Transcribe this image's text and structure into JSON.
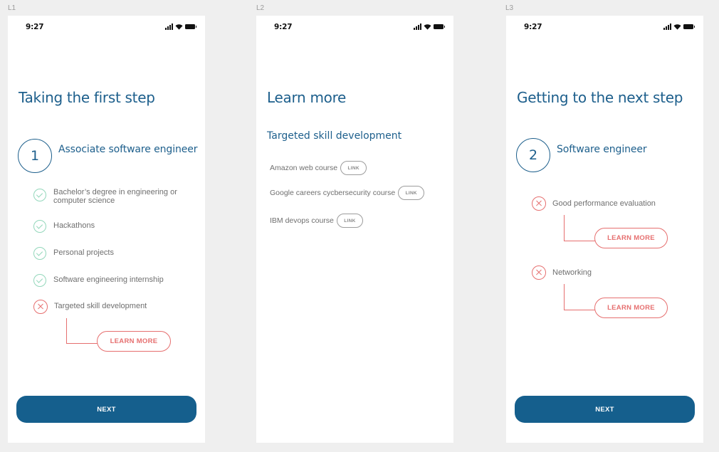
{
  "frames": [
    {
      "label": "L1",
      "time": "9:27",
      "title": "Taking the first step",
      "step_number": "1",
      "step_title": "Associate software engineer",
      "items": [
        {
          "text": "Bachelor’s degree in engineering or computer science",
          "status": "done"
        },
        {
          "text": "Hackathons",
          "status": "done"
        },
        {
          "text": "Personal projects",
          "status": "done"
        },
        {
          "text": "Software engineering internship",
          "status": "done"
        },
        {
          "text": "Targeted skill development",
          "status": "missing"
        }
      ],
      "learn_more": "LEARN MORE",
      "next": "NEXT"
    },
    {
      "label": "L2",
      "time": "9:27",
      "title": "Learn more",
      "subtitle": "Targeted skill development",
      "courses": [
        {
          "name": "Amazon web course",
          "link": "LINK"
        },
        {
          "name": "Google careers cycbersecurity course",
          "link": "LINK"
        },
        {
          "name": "IBM devops course",
          "link": "LINK"
        }
      ]
    },
    {
      "label": "L3",
      "time": "9:27",
      "title": "Getting to the next step",
      "step_number": "2",
      "step_title": "Software engineer",
      "items": [
        {
          "text": "Good performance evaluation",
          "status": "missing",
          "learn_more": "LEARN MORE"
        },
        {
          "text": "Networking",
          "status": "missing",
          "learn_more": "LEARN MORE"
        }
      ],
      "next": "NEXT"
    }
  ],
  "colors": {
    "primary": "#155f8d",
    "title": "#1d5f8c",
    "check": "#93d7bb",
    "error": "#e66f6f",
    "body_text": "#6f6f6f",
    "canvas": "#efefef"
  },
  "icons": [
    "signal-icon",
    "wifi-icon",
    "battery-icon",
    "check-circle-icon",
    "x-circle-icon"
  ]
}
